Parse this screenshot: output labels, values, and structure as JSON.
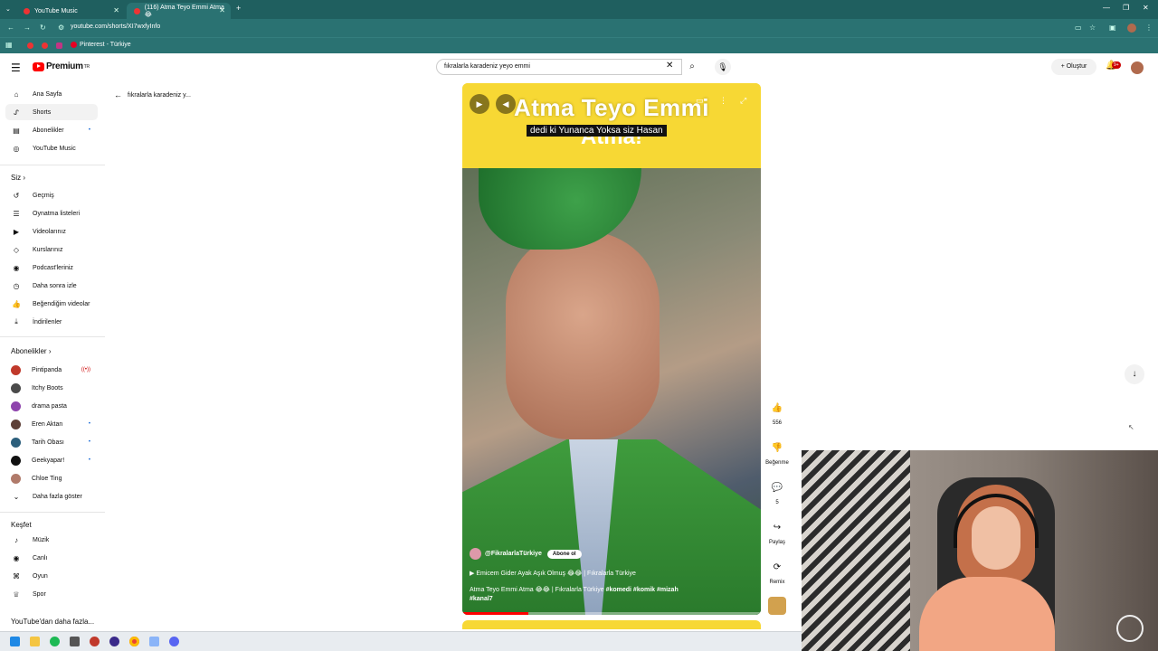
{
  "browser": {
    "tabs": [
      {
        "title": "YouTube Music"
      },
      {
        "title": "(116) Atma Teyo Emmi Atma 😂"
      }
    ],
    "url": "youtube.com/shorts/XI7wxfyInfo",
    "bookmarks": [
      {
        "label": "Pinterest - Türkiye"
      }
    ]
  },
  "header": {
    "logo_text": "Premium",
    "logo_sup": "TR",
    "search_value": "fıkralarla karadeniz yeyo emmi",
    "create_label": "Oluştur",
    "notification_count": "9+"
  },
  "sidebar": {
    "main": [
      {
        "label": "Ana Sayfa",
        "icon": "home-icon"
      },
      {
        "label": "Shorts",
        "icon": "shorts-icon"
      },
      {
        "label": "Abonelikler",
        "icon": "subscriptions-icon"
      },
      {
        "label": "YouTube Music",
        "icon": "music-icon"
      }
    ],
    "you_heading": "Siz",
    "you": [
      {
        "label": "Geçmiş",
        "icon": "history-icon"
      },
      {
        "label": "Oynatma listeleri",
        "icon": "playlist-icon"
      },
      {
        "label": "Videolarınız",
        "icon": "video-icon"
      },
      {
        "label": "Kurslarınız",
        "icon": "courses-icon"
      },
      {
        "label": "Podcast'leriniz",
        "icon": "podcast-icon"
      },
      {
        "label": "Daha sonra izle",
        "icon": "watch-later-icon"
      },
      {
        "label": "Beğendiğim videolar",
        "icon": "liked-icon"
      },
      {
        "label": "İndirilenler",
        "icon": "download-icon"
      }
    ],
    "subs_heading": "Abonelikler",
    "subs": [
      {
        "label": "Pintipanda",
        "color": "#c0392b"
      },
      {
        "label": "Itchy Boots",
        "color": "#4a4a4a"
      },
      {
        "label": "drama pasta",
        "color": "#8e44ad"
      },
      {
        "label": "Eren Aktan",
        "color": "#5d4037"
      },
      {
        "label": "Tarih Obası",
        "color": "#2c5f7c"
      },
      {
        "label": "Geekyapar!",
        "color": "#111111"
      },
      {
        "label": "Chloe Ting",
        "color": "#b07a6a"
      }
    ],
    "show_more": "Daha fazla göster",
    "explore_heading": "Keşfet",
    "explore": [
      {
        "label": "Müzik",
        "icon": "music-note-icon"
      },
      {
        "label": "Canlı",
        "icon": "live-icon"
      },
      {
        "label": "Oyun",
        "icon": "gaming-icon"
      },
      {
        "label": "Spor",
        "icon": "trophy-icon"
      }
    ],
    "more_from_youtube": "YouTube'dan daha fazla..."
  },
  "breadcrumb": "fıkralarla karadeniz y...",
  "video": {
    "overlay_title_line1": "Atma Teyo Emmi",
    "overlay_title_line2": "Atma!",
    "subtitle": "dedi ki Yunanca Yoksa siz Hasan",
    "channel": "@FikralarlaTürkiye",
    "subscribe": "Abone ol",
    "link_line": "Emicem Gider Ayak Aşık Olmuş 😂😂 | Fıkralarla Türkiye",
    "description": "Atma Teyo Emmi Atma 😂😂 | Fıkralarla Türkiye",
    "hashtags": "#komedi #komik #mizah",
    "hashtags2": "#kanal7",
    "progress_fraction": 0.22
  },
  "actions": {
    "likes": "556",
    "dislike": "Beğenme",
    "comments": "5",
    "share": "Paylaş",
    "remix": "Remix"
  }
}
